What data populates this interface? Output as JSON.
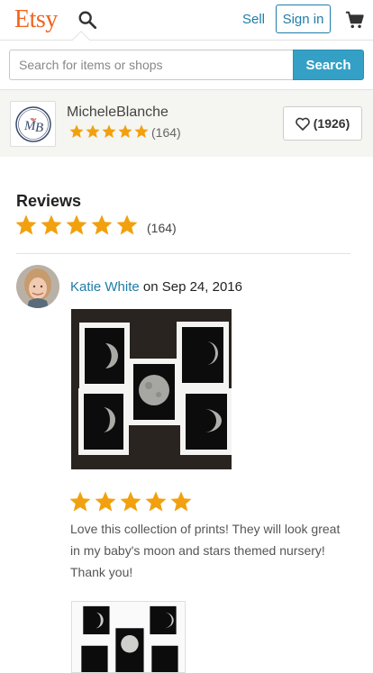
{
  "header": {
    "logo": "Etsy",
    "sell_label": "Sell",
    "signin_label": "Sign in"
  },
  "search": {
    "placeholder": "Search for items or shops",
    "button_label": "Search"
  },
  "shop": {
    "name": "MicheleBlanche",
    "logo_text": "MB",
    "rating_count": "(164)",
    "favorites_label": "(1926)"
  },
  "reviews": {
    "title": "Reviews",
    "count": "(164)",
    "rating": 5,
    "items": [
      {
        "reviewer": "Katie White",
        "on_label": " on ",
        "date": "Sep 24, 2016",
        "rating": 5,
        "text": "Love this collection of prints! They will look great in my baby's moon and stars themed nursery! Thank you!"
      }
    ]
  },
  "colors": {
    "brand": "#f1641e",
    "link": "#1f7ca8",
    "search_button": "#34a0c5",
    "star": "#f1a10f"
  },
  "icons": [
    "search-icon",
    "cart-icon",
    "heart-icon",
    "star-icon"
  ]
}
